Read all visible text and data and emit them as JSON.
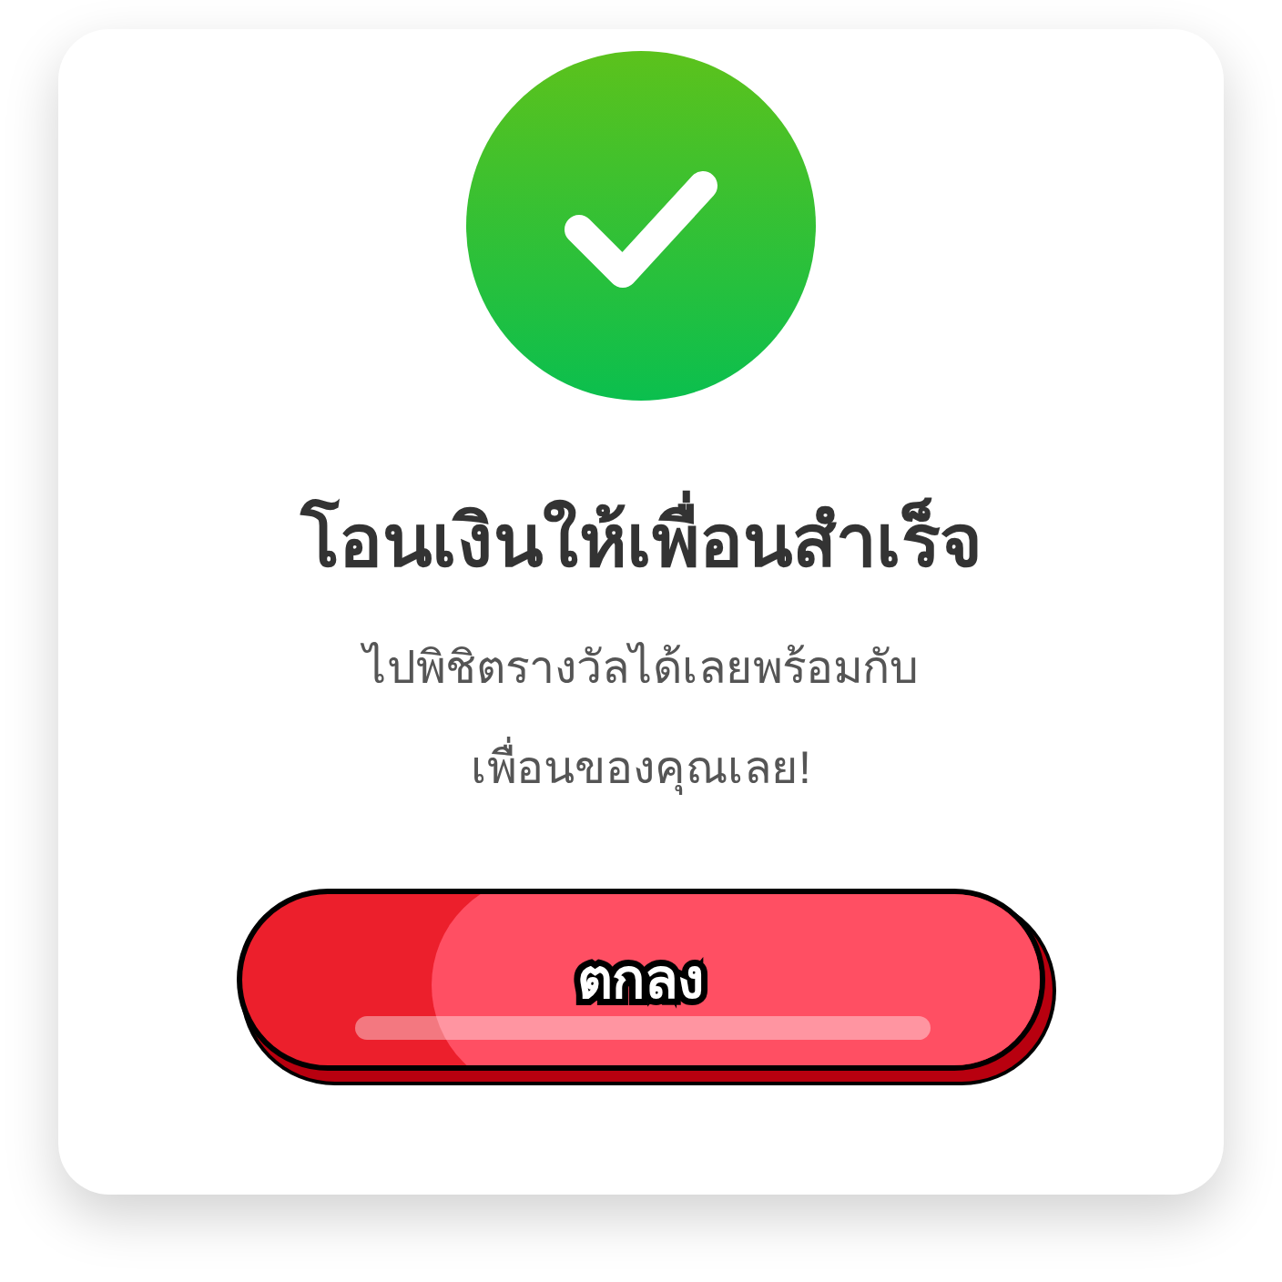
{
  "dialog": {
    "title": "โอนเงินให้เพื่อนสำเร็จ",
    "message_lines": [
      "ไปพิชิตรางวัลได้เลยพร้อมกับ",
      "เพื่อนของคุณเลย!"
    ],
    "button": {
      "label": "ตกลง"
    }
  }
}
